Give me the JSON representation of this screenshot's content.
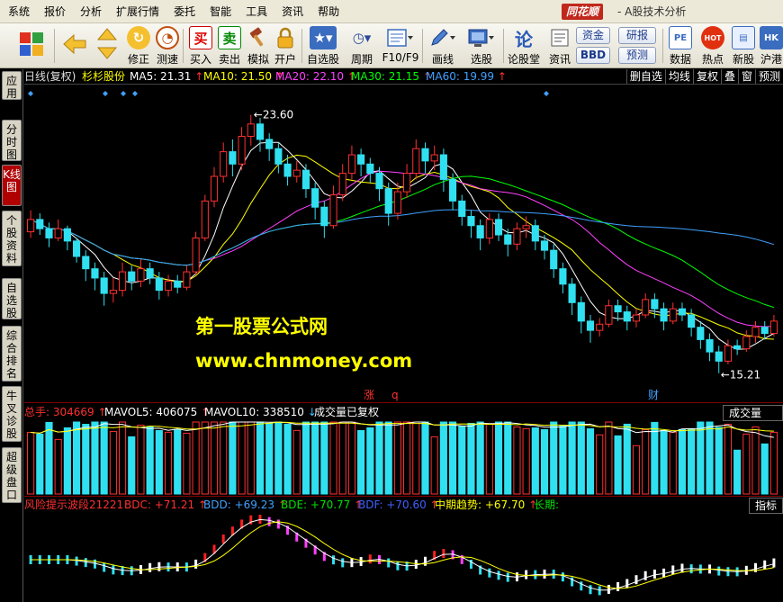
{
  "menu": [
    "系统",
    "报价",
    "分析",
    "扩展行情",
    "委托",
    "智能",
    "工具",
    "资讯",
    "帮助"
  ],
  "brand": "同花顺",
  "window_title": "- A股技术分析",
  "toolbar": {
    "buttons": [
      {
        "label": "修正",
        "icon": "correct-icon"
      },
      {
        "label": "测速",
        "icon": "speed-test-icon"
      },
      {
        "label": "买入",
        "icon": "buy-icon",
        "glyph": "买"
      },
      {
        "label": "卖出",
        "icon": "sell-icon",
        "glyph": "卖"
      },
      {
        "label": "模拟",
        "icon": "hammer-icon"
      },
      {
        "label": "开户",
        "icon": "lock-icon"
      },
      {
        "label": "自选股",
        "icon": "star-icon"
      },
      {
        "label": "周期",
        "icon": "clock-icon"
      },
      {
        "label": "F10/F9",
        "icon": "f10-icon"
      },
      {
        "label": "画线",
        "icon": "pencil-icon"
      },
      {
        "label": "选股",
        "icon": "monitor-icon"
      },
      {
        "label": "论股堂",
        "icon": "forum-icon"
      },
      {
        "label": "资讯",
        "icon": "news-icon"
      },
      {
        "label": "数据",
        "icon": "pe-icon",
        "glyph": "PE"
      },
      {
        "label": "热点",
        "icon": "hot-icon",
        "glyph": "HOT"
      },
      {
        "label": "新股",
        "icon": "ipo-icon"
      },
      {
        "label": "沪港",
        "icon": "hk-icon",
        "glyph": "HK"
      }
    ],
    "fund_label": "资金",
    "bbd_label": "BBD",
    "research_label": "研报",
    "forecast_label": "预测"
  },
  "side_tabs": [
    "应用",
    "分时图",
    "K线图",
    "个股资料",
    "自选股",
    "综合排名",
    "牛叉诊股",
    "超级盘口"
  ],
  "header": {
    "chart_type": "日线(复权)",
    "stock_name": "杉杉股份",
    "ma": [
      {
        "label": "MA5: 21.31",
        "color": "#ffffff"
      },
      {
        "label": "MA10: 21.50",
        "color": "#ffff00"
      },
      {
        "label": "MA20: 22.10",
        "color": "#ff40ff"
      },
      {
        "label": "MA30: 21.15",
        "color": "#00ff00"
      },
      {
        "label": "MA60: 19.99",
        "color": "#40a0ff"
      }
    ],
    "right_tools": [
      "删自选",
      "均线",
      "复权",
      "叠",
      "窗",
      "预测"
    ]
  },
  "chart_data": {
    "type": "candlestick",
    "price_range": [
      14.5,
      24.2
    ],
    "high_label": "23.60",
    "low_label": "15.21",
    "markers": [
      "涨",
      "q",
      "财"
    ],
    "candles": [
      [
        19.8,
        20.2,
        20.5,
        19.6
      ],
      [
        20.2,
        19.9,
        20.4,
        19.7
      ],
      [
        19.9,
        19.6,
        20.1,
        19.3
      ],
      [
        19.6,
        19.9,
        20.2,
        19.5
      ],
      [
        19.9,
        19.5,
        20.0,
        19.2
      ],
      [
        19.5,
        19.0,
        19.6,
        18.8
      ],
      [
        19.0,
        18.6,
        19.2,
        18.2
      ],
      [
        18.6,
        18.3,
        18.8,
        17.9
      ],
      [
        18.3,
        17.8,
        18.5,
        17.4
      ],
      [
        17.8,
        17.9,
        18.3,
        17.5
      ],
      [
        17.9,
        18.5,
        18.8,
        17.7
      ],
      [
        18.5,
        18.2,
        18.7,
        17.9
      ],
      [
        18.2,
        18.6,
        18.9,
        18.0
      ],
      [
        18.6,
        18.3,
        18.8,
        18.1
      ],
      [
        18.3,
        17.9,
        18.5,
        17.6
      ],
      [
        17.9,
        18.2,
        18.4,
        17.7
      ],
      [
        18.2,
        18.0,
        18.4,
        17.8
      ],
      [
        18.0,
        18.5,
        18.7,
        17.9
      ],
      [
        18.5,
        19.6,
        19.8,
        18.4
      ],
      [
        19.6,
        20.8,
        21.0,
        19.5
      ],
      [
        20.8,
        21.6,
        21.9,
        20.6
      ],
      [
        21.6,
        22.4,
        22.7,
        21.4
      ],
      [
        22.4,
        22.0,
        22.8,
        21.6
      ],
      [
        22.0,
        22.9,
        23.2,
        21.8
      ],
      [
        22.9,
        23.3,
        23.6,
        22.6
      ],
      [
        23.3,
        22.8,
        23.5,
        22.4
      ],
      [
        22.8,
        22.5,
        23.0,
        22.1
      ],
      [
        22.5,
        22.0,
        22.7,
        21.7
      ],
      [
        22.0,
        21.6,
        22.3,
        21.3
      ],
      [
        21.6,
        21.8,
        22.1,
        21.4
      ],
      [
        21.8,
        21.2,
        22.0,
        20.9
      ],
      [
        21.2,
        20.6,
        21.4,
        20.2
      ],
      [
        20.6,
        20.0,
        20.8,
        19.6
      ],
      [
        20.0,
        21.0,
        21.3,
        19.9
      ],
      [
        21.0,
        21.7,
        22.0,
        20.8
      ],
      [
        21.7,
        22.3,
        22.6,
        21.5
      ],
      [
        22.3,
        22.0,
        22.5,
        21.6
      ],
      [
        22.0,
        21.7,
        22.2,
        21.4
      ],
      [
        21.7,
        21.2,
        21.9,
        20.8
      ],
      [
        21.2,
        20.4,
        21.4,
        20.0
      ],
      [
        20.4,
        21.1,
        21.4,
        20.2
      ],
      [
        21.1,
        21.7,
        22.0,
        20.9
      ],
      [
        21.7,
        22.5,
        22.8,
        21.5
      ],
      [
        22.5,
        22.1,
        22.7,
        21.7
      ],
      [
        22.1,
        22.3,
        22.6,
        21.8
      ],
      [
        22.3,
        21.5,
        22.5,
        21.1
      ],
      [
        21.5,
        20.8,
        21.7,
        20.5
      ],
      [
        20.8,
        20.3,
        21.0,
        20.0
      ],
      [
        20.3,
        20.0,
        20.5,
        19.6
      ],
      [
        20.0,
        19.6,
        20.2,
        19.2
      ],
      [
        19.6,
        20.2,
        20.4,
        19.4
      ],
      [
        20.2,
        19.7,
        20.4,
        19.5
      ],
      [
        19.7,
        19.4,
        19.9,
        19.0
      ],
      [
        19.4,
        19.9,
        20.1,
        19.2
      ],
      [
        19.9,
        20.0,
        20.3,
        19.6
      ],
      [
        20.0,
        19.5,
        20.2,
        19.2
      ],
      [
        19.5,
        19.2,
        19.7,
        18.9
      ],
      [
        19.2,
        18.6,
        19.4,
        18.3
      ],
      [
        18.6,
        18.1,
        18.8,
        17.8
      ],
      [
        18.1,
        17.5,
        18.3,
        17.1
      ],
      [
        17.5,
        16.9,
        17.7,
        16.5
      ],
      [
        16.9,
        16.6,
        17.1,
        16.2
      ],
      [
        16.6,
        16.8,
        17.0,
        16.4
      ],
      [
        16.8,
        17.4,
        17.6,
        16.7
      ],
      [
        17.4,
        17.2,
        17.6,
        16.9
      ],
      [
        17.2,
        16.9,
        17.4,
        16.6
      ],
      [
        16.9,
        17.1,
        17.3,
        16.7
      ],
      [
        17.1,
        17.6,
        17.8,
        17.0
      ],
      [
        17.6,
        17.3,
        17.8,
        17.0
      ],
      [
        17.3,
        16.9,
        17.5,
        16.6
      ],
      [
        16.9,
        17.3,
        17.5,
        16.8
      ],
      [
        17.3,
        17.1,
        17.5,
        16.9
      ],
      [
        17.1,
        16.7,
        17.3,
        16.4
      ],
      [
        16.7,
        16.3,
        16.9,
        16.0
      ],
      [
        16.3,
        15.9,
        16.5,
        15.6
      ],
      [
        15.9,
        15.6,
        16.1,
        15.21
      ],
      [
        15.6,
        16.1,
        16.3,
        15.5
      ],
      [
        16.1,
        16.0,
        16.3,
        15.8
      ],
      [
        16.0,
        16.4,
        16.6,
        15.9
      ],
      [
        16.4,
        16.7,
        16.9,
        16.2
      ],
      [
        16.7,
        16.5,
        16.9,
        16.3
      ],
      [
        16.5,
        16.9,
        17.1,
        16.4
      ]
    ]
  },
  "volume_panel": {
    "total": "总手: 304669",
    "mavol5": "MAVOL5: 406075",
    "mavol10": "MAVOL10: 338510",
    "note": "成交量已复权",
    "button": "成交量"
  },
  "indicator_panel": {
    "title": "风险提示波段21221",
    "bdc": "BDC: +71.21",
    "bdd": "BDD: +69.23",
    "bde": "BDE: +70.77",
    "bdf": "BDF: +70.60",
    "trend": "中期趋势: +67.70",
    "long": "长期:",
    "button": "指标说"
  },
  "watermark": {
    "cn": "第一股票公式网",
    "url": "www.chnmoney.com"
  },
  "colors": {
    "up": "#ff3030",
    "down": "#30e0f0",
    "ma5": "#ffffff",
    "ma10": "#ffff00",
    "ma20": "#ff40ff",
    "ma30": "#00ff00",
    "ma60": "#40a0ff"
  }
}
